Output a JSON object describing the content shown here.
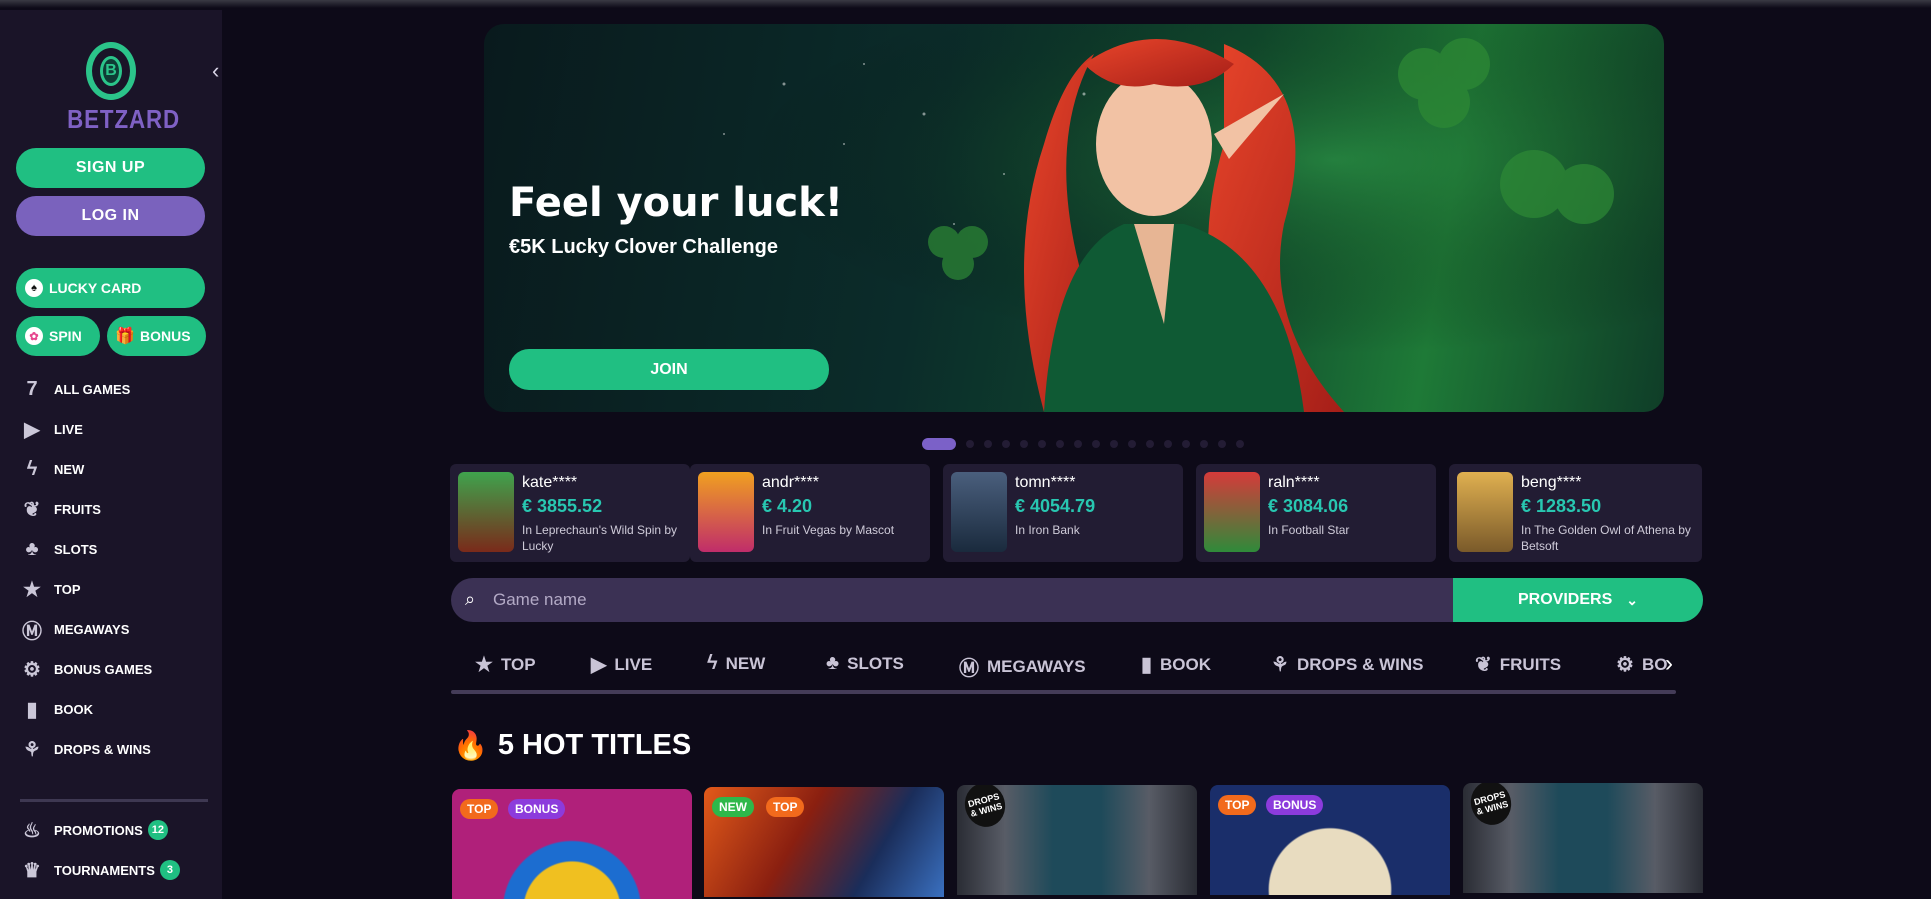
{
  "brand": {
    "name": "BETZARD",
    "logo_letter": "B"
  },
  "auth": {
    "signup": "SIGN UP",
    "login": "LOG IN"
  },
  "promos": {
    "lucky_card": "LUCKY CARD",
    "spin": "SPIN",
    "bonus": "BONUS"
  },
  "nav": [
    {
      "label": "ALL GAMES",
      "icon": "seven-icon"
    },
    {
      "label": "LIVE",
      "icon": "play-icon"
    },
    {
      "label": "NEW",
      "icon": "bolt-icon"
    },
    {
      "label": "FRUITS",
      "icon": "fruit-icon"
    },
    {
      "label": "SLOTS",
      "icon": "cherries-icon"
    },
    {
      "label": "TOP",
      "icon": "star-icon"
    },
    {
      "label": "MEGAWAYS",
      "icon": "megaways-icon"
    },
    {
      "label": "BONUS GAMES",
      "icon": "gear-icon"
    },
    {
      "label": "BOOK",
      "icon": "book-icon"
    },
    {
      "label": "DROPS & WINS",
      "icon": "drops-icon"
    }
  ],
  "extras": [
    {
      "label": "PROMOTIONS",
      "badge": "12",
      "icon": "promo-icon"
    },
    {
      "label": "TOURNAMENTS",
      "badge": "3",
      "icon": "trophy-icon"
    }
  ],
  "hero": {
    "title": "Feel your luck!",
    "subtitle": "€5K Lucky Clover Challenge",
    "cta": "JOIN"
  },
  "carousel": {
    "total": 17,
    "active": 0
  },
  "wins": [
    {
      "user": "kate****",
      "amount": "€ 3855.52",
      "game": "In Leprechaun's Wild Spin by Lucky"
    },
    {
      "user": "andr****",
      "amount": "€ 4.20",
      "game": "In Fruit Vegas by Mascot"
    },
    {
      "user": "tomn****",
      "amount": "€ 4054.79",
      "game": "In Iron Bank"
    },
    {
      "user": "raln****",
      "amount": "€ 3084.06",
      "game": "In Football Star"
    },
    {
      "user": "beng****",
      "amount": "€ 1283.50",
      "game": "In The Golden Owl of Athena by Betsoft"
    }
  ],
  "search": {
    "placeholder": "Game name",
    "providers": "PROVIDERS"
  },
  "categories": [
    {
      "label": "TOP",
      "icon": "star-icon"
    },
    {
      "label": "LIVE",
      "icon": "play-icon"
    },
    {
      "label": "NEW",
      "icon": "bolt-icon"
    },
    {
      "label": "SLOTS",
      "icon": "cherries-icon"
    },
    {
      "label": "MEGAWAYS",
      "icon": "megaways-icon"
    },
    {
      "label": "BOOK",
      "icon": "book-icon"
    },
    {
      "label": "DROPS & WINS",
      "icon": "drops-icon"
    },
    {
      "label": "FRUITS",
      "icon": "fruit-icon"
    },
    {
      "label": "BO",
      "icon": "gear-icon"
    }
  ],
  "hot": {
    "title": "5 HOT TITLES"
  },
  "tiles": [
    {
      "tags": [
        "TOP",
        "BONUS"
      ],
      "dw": ""
    },
    {
      "tags": [
        "NEW",
        "TOP"
      ],
      "dw": ""
    },
    {
      "tags": [],
      "dw": "DROPS & WINS"
    },
    {
      "tags": [
        "TOP",
        "BONUS"
      ],
      "dw": ""
    },
    {
      "tags": [],
      "dw": "DROPS & WINS"
    }
  ],
  "colors": {
    "accent_green": "#20bf82",
    "accent_purple": "#7a62bd",
    "win_amount": "#28c7b1",
    "background": "#0d0a18"
  }
}
